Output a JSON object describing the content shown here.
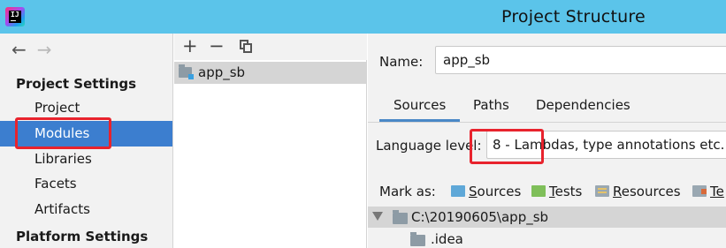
{
  "window": {
    "title": "Project Structure"
  },
  "sidebar": {
    "project_settings_header": "Project Settings",
    "items": [
      {
        "label": "Project"
      },
      {
        "label": "Modules",
        "selected": true
      },
      {
        "label": "Libraries"
      },
      {
        "label": "Facets"
      },
      {
        "label": "Artifacts"
      }
    ],
    "platform_settings_header": "Platform Settings"
  },
  "modules_panel": {
    "toolbar": {
      "add": "+",
      "remove": "−"
    },
    "modules": [
      {
        "name": "app_sb"
      }
    ]
  },
  "details": {
    "name_label": "Name:",
    "name_value": "app_sb",
    "tabs": [
      {
        "label": "Sources",
        "active": true
      },
      {
        "label": "Paths"
      },
      {
        "label": "Dependencies"
      }
    ],
    "language_level_label": "Language level:",
    "language_level_value": "8 - Lambdas, type annotations etc.",
    "mark_as_label": "Mark as:",
    "mark_as": [
      {
        "first": "S",
        "rest": "ources",
        "icon": "sources-folder-icon"
      },
      {
        "first": "T",
        "rest": "ests",
        "icon": "tests-folder-icon"
      },
      {
        "first": "R",
        "rest": "esources",
        "icon": "resources-folder-icon"
      },
      {
        "first": "Te",
        "rest": "",
        "icon": "test-resources-folder-icon"
      }
    ],
    "tree": [
      {
        "label": "C:\\20190605\\app_sb",
        "expanded": true
      },
      {
        "label": ".idea"
      }
    ]
  },
  "colors": {
    "titlebar": "#5bc4ea",
    "selection": "#3c7ecf",
    "highlight_box": "#e8232d",
    "tab_underline": "#4a88c7"
  }
}
